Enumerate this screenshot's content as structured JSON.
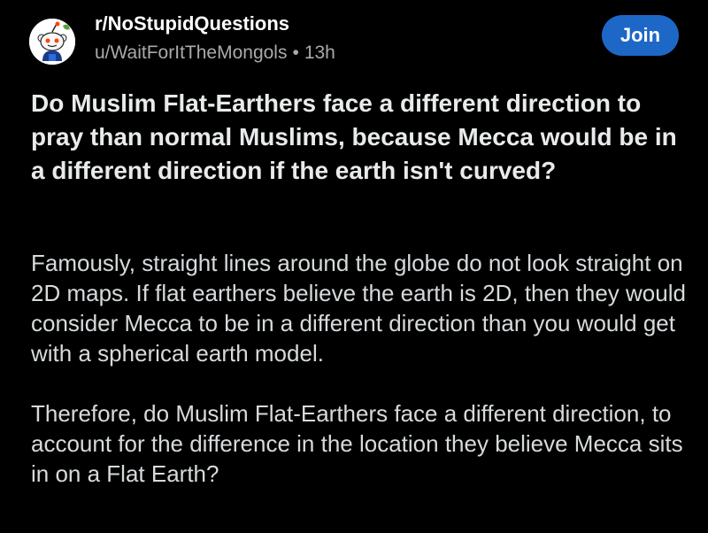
{
  "post": {
    "subreddit": "r/NoStupidQuestions",
    "author": "u/WaitForItTheMongols",
    "separator": "•",
    "age": "13h",
    "join_label": "Join",
    "title": "Do Muslim Flat-Earthers face a different direction to pray than normal Muslims, because Mecca would be in a different direction if the earth isn't curved?",
    "body": [
      "Famously, straight lines around the globe do not look straight on 2D maps. If flat earthers believe the earth is 2D, then they would consider Mecca to be in a different direction than you would get with a spherical earth model.",
      "Therefore, do Muslim Flat-Earthers face a different direction, to account for the difference in the location they believe Mecca sits in on a Flat Earth?"
    ]
  },
  "colors": {
    "background": "#000000",
    "join_button": "#1d67c7",
    "meta_text": "#a8aaab"
  },
  "icons": {
    "avatar": "subreddit-snoo-avatar-icon"
  }
}
